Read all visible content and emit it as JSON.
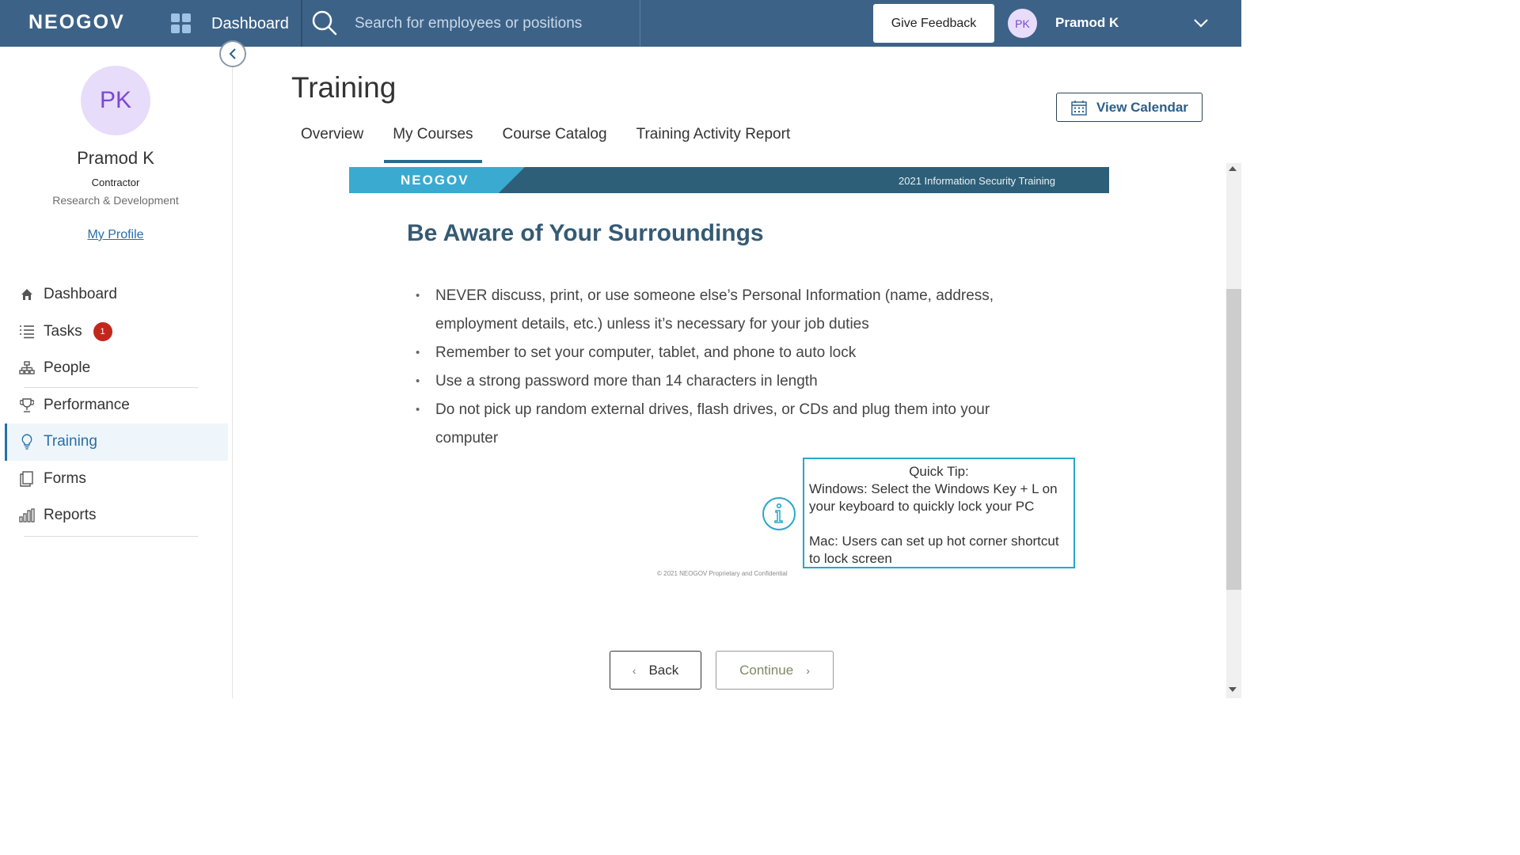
{
  "topbar": {
    "brand": "NEOGOV",
    "dashboard_label": "Dashboard",
    "search_placeholder": "Search for employees or positions",
    "feedback_label": "Give Feedback",
    "user_initials": "PK",
    "user_name": "Pramod K"
  },
  "profile": {
    "initials": "PK",
    "name": "Pramod K",
    "role": "Contractor",
    "department": "Research & Development",
    "link_label": "My Profile"
  },
  "nav": {
    "items": [
      {
        "label": "Dashboard",
        "icon": "home-icon"
      },
      {
        "label": "Tasks",
        "icon": "list-icon",
        "badge": "1"
      },
      {
        "label": "People",
        "icon": "org-chart-icon"
      },
      {
        "label": "Performance",
        "icon": "trophy-icon"
      },
      {
        "label": "Training",
        "icon": "lightbulb-icon",
        "active": true
      },
      {
        "label": "Forms",
        "icon": "forms-icon"
      },
      {
        "label": "Reports",
        "icon": "bar-chart-icon"
      }
    ]
  },
  "page": {
    "title": "Training",
    "calendar_label": "View Calendar",
    "tabs": [
      "Overview",
      "My Courses",
      "Course Catalog",
      "Training Activity Report"
    ],
    "active_tab": "My Courses"
  },
  "slide": {
    "brand": "NEOGOV",
    "course_title": "2021 Information Security Training",
    "heading": "Be Aware of Your Surroundings",
    "bullets": [
      "NEVER discuss, print, or use someone else’s Personal Information (name, address, employment details, etc.) unless it’s necessary for your job duties",
      "Remember to set your computer, tablet, and phone to auto lock",
      "Use a strong password more than 14 characters in length",
      "Do not pick up random external drives, flash drives, or CDs and plug them into your computer"
    ],
    "tip": {
      "title": "Quick Tip:",
      "windows": "Windows: Select the Windows Key + L on your keyboard to quickly lock your PC",
      "mac": "Mac: Users can set up hot corner shortcut to lock screen"
    },
    "copyright": "© 2021 NEOGOV Proprietary and Confidential"
  },
  "footer": {
    "back_label": "Back",
    "continue_label": "Continue"
  },
  "colors": {
    "topbar": "#3d6287",
    "accent": "#2a6ea6",
    "badge": "#c3271b",
    "slide_header": "#2e5f78",
    "slide_tag": "#3aaad0",
    "tip_border": "#27a8c9"
  }
}
